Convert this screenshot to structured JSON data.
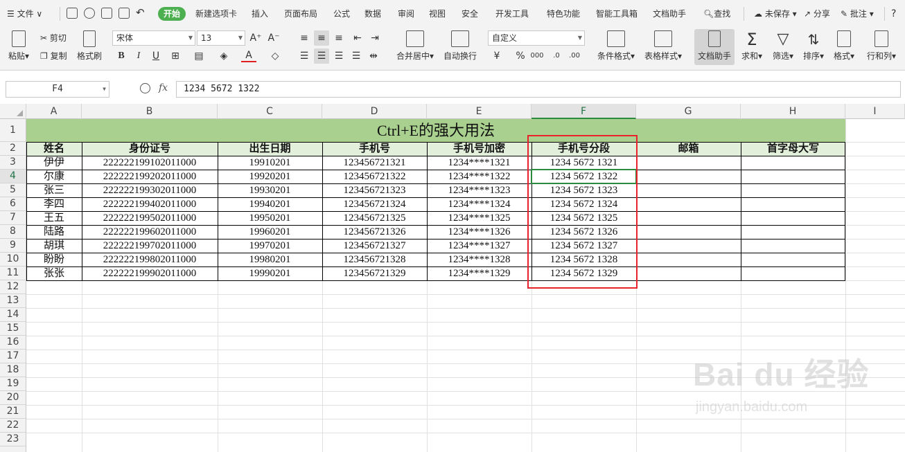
{
  "menu": {
    "file": "文件",
    "tabs": [
      "开始",
      "新建选项卡",
      "插入",
      "页面布局",
      "公式",
      "数据",
      "审阅",
      "视图",
      "安全",
      "开发工具",
      "特色功能",
      "智能工具箱",
      "文档助手"
    ],
    "active_tab": "开始",
    "search": "查找",
    "unsaved": "未保存",
    "share": "分享",
    "comment": "批注",
    "help": "?"
  },
  "ribbon": {
    "paste": "粘贴",
    "cut": "剪切",
    "copy": "复制",
    "format_painter": "格式刷",
    "font_name": "宋体",
    "font_size": "13",
    "merge_center": "合并居中",
    "wrap_text": "自动换行",
    "number_format": "自定义",
    "conditional_format": "条件格式",
    "table_style": "表格样式",
    "doc_assistant": "文档助手",
    "sum": "求和",
    "filter": "筛选",
    "sort": "排序",
    "format": "格式",
    "rows_cols": "行和列"
  },
  "formula_bar": {
    "name_box": "F4",
    "fx": "fx",
    "content": "1234 5672 1322"
  },
  "grid": {
    "columns": [
      "A",
      "B",
      "C",
      "D",
      "E",
      "F",
      "G",
      "H",
      "I"
    ],
    "selected_column": "F",
    "selected_row": "4",
    "rows": [
      "1",
      "2",
      "3",
      "4",
      "5",
      "6",
      "7",
      "8",
      "9",
      "10",
      "11",
      "12",
      "13",
      "14",
      "15",
      "16",
      "17",
      "18",
      "19",
      "20",
      "21",
      "22",
      "23"
    ],
    "title": "Ctrl+E的强大用法",
    "headers": [
      "姓名",
      "身份证号",
      "出生日期",
      "手机号",
      "手机号加密",
      "手机号分段",
      "邮箱",
      "首字母大写"
    ],
    "data": [
      [
        "伊伊",
        "222222199102011000",
        "19910201",
        "123456721321",
        "1234****1321",
        "1234 5672 1321",
        "",
        ""
      ],
      [
        "尔康",
        "222222199202011000",
        "19920201",
        "123456721322",
        "1234****1322",
        "1234 5672 1322",
        "",
        ""
      ],
      [
        "张三",
        "222222199302011000",
        "19930201",
        "123456721323",
        "1234****1323",
        "1234 5672 1323",
        "",
        ""
      ],
      [
        "李四",
        "222222199402011000",
        "19940201",
        "123456721324",
        "1234****1324",
        "1234 5672 1324",
        "",
        ""
      ],
      [
        "王五",
        "222222199502011000",
        "19950201",
        "123456721325",
        "1234****1325",
        "1234 5672 1325",
        "",
        ""
      ],
      [
        "陆路",
        "222222199602011000",
        "19960201",
        "123456721326",
        "1234****1326",
        "1234 5672 1326",
        "",
        ""
      ],
      [
        "胡琪",
        "222222199702011000",
        "19970201",
        "123456721327",
        "1234****1327",
        "1234 5672 1327",
        "",
        ""
      ],
      [
        "盼盼",
        "222222199802011000",
        "19980201",
        "123456721328",
        "1234****1328",
        "1234 5672 1328",
        "",
        ""
      ],
      [
        "张张",
        "222222199902011000",
        "19990201",
        "123456721329",
        "1234****1329",
        "1234 5672 1329",
        "",
        ""
      ]
    ]
  },
  "colors": {
    "title_fill": "#a9d08e",
    "header_fill": "#e2efda",
    "selection": "#2b8a3e",
    "highlight_box": "#e8212a",
    "active_tab": "#4caf50"
  },
  "watermark": {
    "logo": "Bai du 经验",
    "url": "jingyan.baidu.com"
  }
}
